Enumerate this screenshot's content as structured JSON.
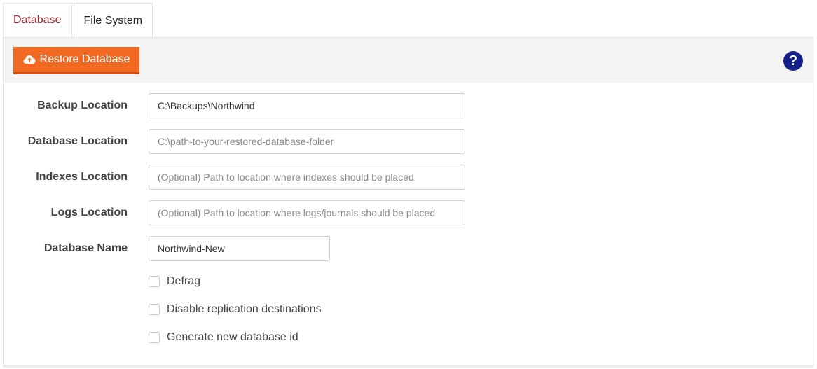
{
  "tabs": [
    {
      "label": "Database"
    },
    {
      "label": "File System"
    }
  ],
  "toolbar": {
    "restore_label": "Restore Database",
    "help_glyph": "?",
    "restore_icon": "cloud-upload-icon",
    "help_icon": "question-circle-icon"
  },
  "form": {
    "backup_location": {
      "label": "Backup Location",
      "value": "C:\\Backups\\Northwind",
      "placeholder": ""
    },
    "database_location": {
      "label": "Database Location",
      "value": "",
      "placeholder": "C:\\path-to-your-restored-database-folder"
    },
    "indexes_location": {
      "label": "Indexes Location",
      "value": "",
      "placeholder": "(Optional) Path to location where indexes should be placed"
    },
    "logs_location": {
      "label": "Logs Location",
      "value": "",
      "placeholder": "(Optional) Path to location where logs/journals should be placed"
    },
    "database_name": {
      "label": "Database Name",
      "value": "Northwind-New",
      "placeholder": ""
    }
  },
  "options": {
    "defrag": {
      "label": "Defrag",
      "checked": false
    },
    "disable_replication": {
      "label": "Disable replication destinations",
      "checked": false
    },
    "new_db_id": {
      "label": "Generate new database id",
      "checked": false
    }
  },
  "colors": {
    "accent": "#f26a22",
    "active_tab": "#a0262b",
    "help": "#16208a"
  }
}
